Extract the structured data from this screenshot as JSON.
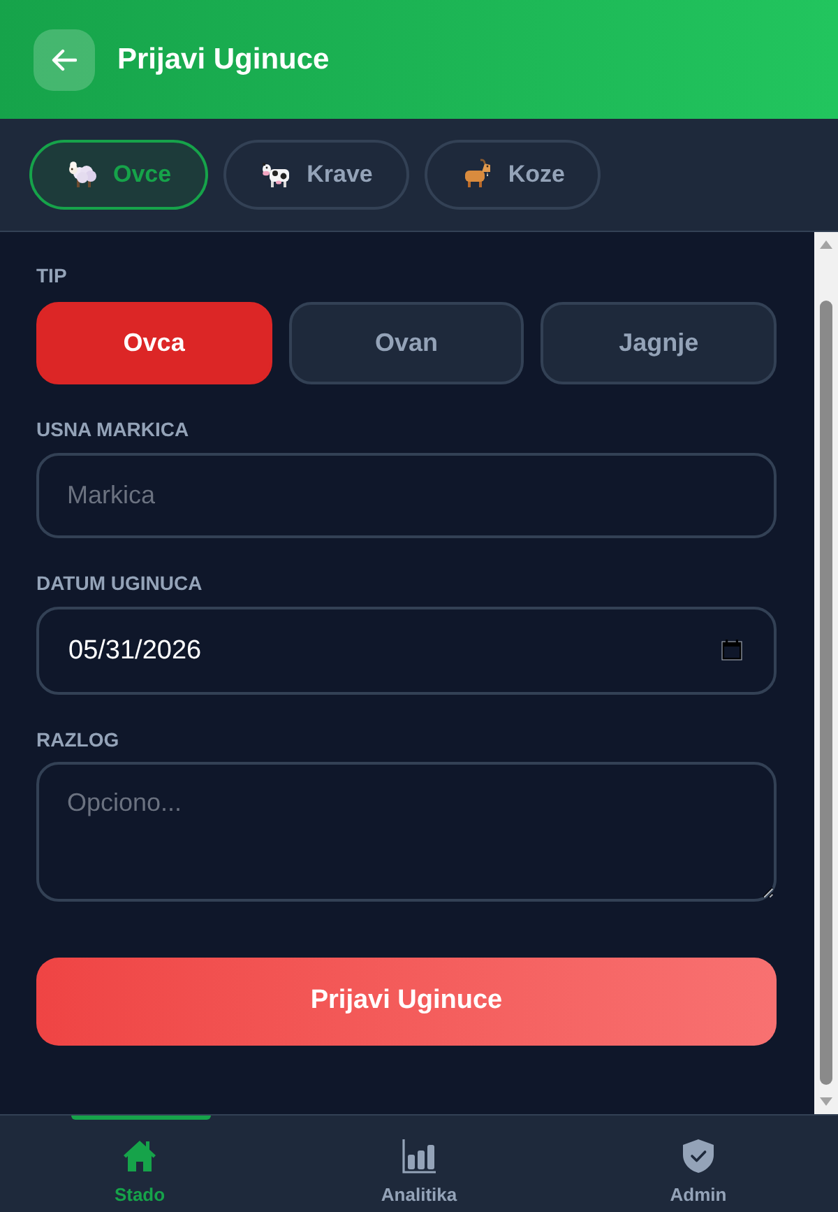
{
  "header": {
    "title": "Prijavi Uginuce"
  },
  "species_tabs": [
    {
      "label": "Ovce",
      "kind": "sheep",
      "selected": true
    },
    {
      "label": "Krave",
      "kind": "cow",
      "selected": false
    },
    {
      "label": "Koze",
      "kind": "goat",
      "selected": false
    }
  ],
  "form": {
    "type_label": "TIP",
    "types": [
      {
        "label": "Ovca",
        "selected": true
      },
      {
        "label": "Ovan",
        "selected": false
      },
      {
        "label": "Jagnje",
        "selected": false
      }
    ],
    "tag_label": "USNA MARKICA",
    "tag_field": {
      "placeholder": "Markica"
    },
    "date_label": "DATUM UGINUCA",
    "date_field": {
      "value": "05/31/2026"
    },
    "reason_label": "RAZLOG",
    "reason_field": {
      "placeholder": "Opciono..."
    },
    "submit": "Prijavi Uginuce"
  },
  "bottom_nav": [
    {
      "label": "Stado",
      "kind": "home",
      "selected": true
    },
    {
      "label": "Analitika",
      "kind": "analytics",
      "selected": false
    },
    {
      "label": "Admin",
      "kind": "admin",
      "selected": false
    }
  ]
}
